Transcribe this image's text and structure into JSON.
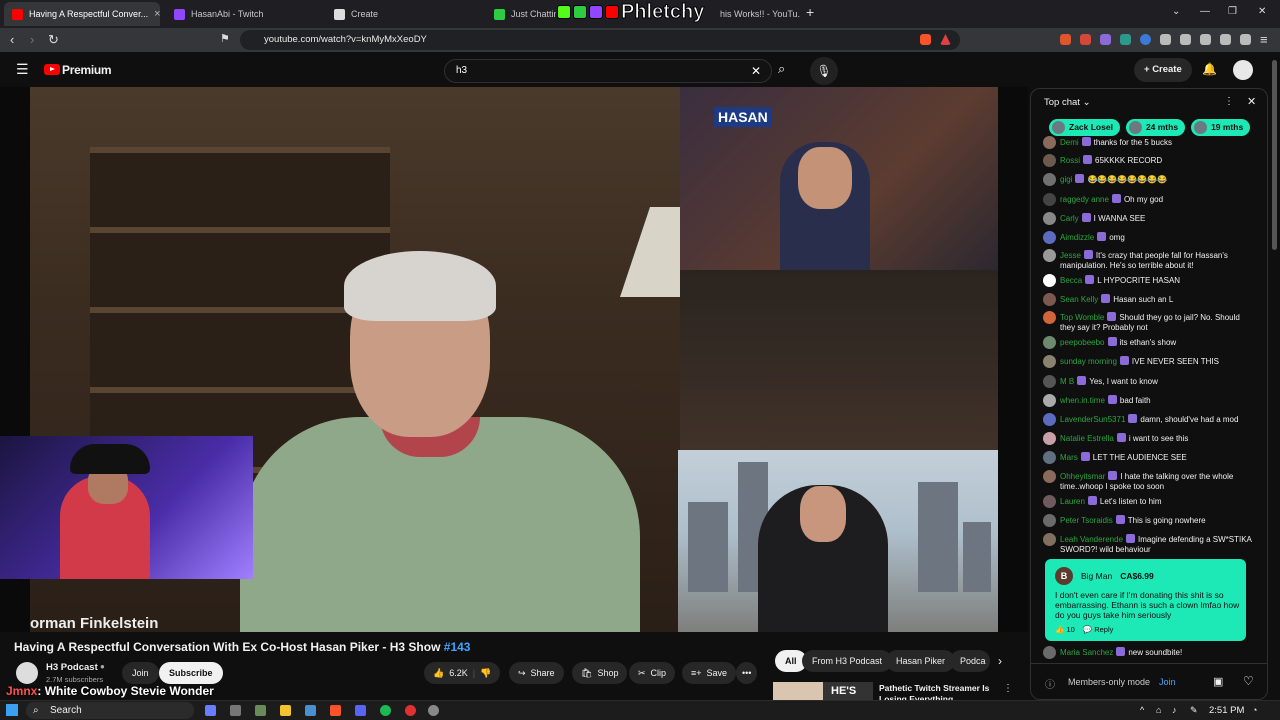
{
  "tabs": [
    {
      "title": "Having A Respectful Conver...",
      "fav": "#ff0000",
      "active": true
    },
    {
      "title": "HasanAbi - Twitch",
      "fav": "#9146ff"
    },
    {
      "title": "Create",
      "fav": "#ffffff"
    },
    {
      "title": "Just Chatting S...",
      "fav": "#2ecc40"
    },
    {
      "title": "his Works!! - YouTu...",
      "fav": "#ff0000"
    }
  ],
  "watermark": "Phletchy",
  "address": {
    "url": "youtube.com/watch?v=knMyMxXeoDY"
  },
  "youtube": {
    "brand": "Premium",
    "search_value": "h3",
    "create_label": "Create"
  },
  "video": {
    "nameplate": "orman Finkelstein",
    "pip_logo": "HASAN",
    "title": "Having A Respectful Conversation With Ex Co-Host Hasan Piker - H3 Show",
    "title_tag": "#143",
    "channel": "H3 Podcast",
    "subscribers": "2.7M subscribers",
    "join": "Join",
    "subscribe": "Subscribe",
    "likes": "6.2K",
    "share": "Share",
    "shop": "Shop",
    "clip": "Clip",
    "save": "Save",
    "more": "•••"
  },
  "overlay": {
    "name": "Jmnx",
    "text": ": White Cowboy Stevie Wonder"
  },
  "related_chips": [
    "All",
    "From H3 Podcast",
    "Hasan Piker",
    "Podca"
  ],
  "related_video": {
    "title_line1": "Pathetic Twitch Streamer Is",
    "title_line2": "Losing Everything",
    "thumb_text": "HE'S"
  },
  "chat": {
    "header": "Top chat",
    "tips": [
      {
        "label": "Zack Losel",
        "color": "#1de9b6"
      },
      {
        "label": "24 mths",
        "color": "#1de9b6"
      },
      {
        "label": "19 mths",
        "color": "#1de9b6"
      }
    ],
    "messages": [
      {
        "name": "Demi",
        "text": "thanks for the 5 bucks",
        "av": "#8a6a5a",
        "name_color": "#2ba640"
      },
      {
        "name": "Rossi",
        "text": "65KKKK RECORD",
        "av": "#6b5a4e",
        "name_color": "#2ba640"
      },
      {
        "name": "gigi",
        "text": "😂😂😂😂😂😂😂😂",
        "av": "#707070",
        "name_color": "#2ba640"
      },
      {
        "name": "raggedy anne",
        "text": "Oh my god",
        "av": "#444",
        "name_color": "#2ba640"
      },
      {
        "name": "Carly",
        "text": "I WANNA SEE",
        "av": "#888",
        "name_color": "#2ba640"
      },
      {
        "name": "Aimdizzle",
        "text": "omg",
        "av": "#5c6bc0",
        "name_color": "#2ba640"
      },
      {
        "name": "Jesse",
        "text": "It's crazy that people fall for Hassan's manipulation. He's so terrible about it!",
        "av": "#999",
        "name_color": "#2ba640"
      },
      {
        "name": "Becca",
        "text": "L HYPOCRITE HASAN",
        "av": "#ffffff",
        "name_color": "#2ba640"
      },
      {
        "name": "Sean Kelly",
        "text": "Hasan such an L",
        "av": "#7a5a50",
        "name_color": "#2ba640"
      },
      {
        "name": "Top Womble",
        "text": "Should they go to jail? No. Should they say it? Probably not",
        "av": "#d0643a",
        "name_color": "#2ba640"
      },
      {
        "name": "peepobeebo",
        "text": "its ethan's show",
        "av": "#6e8a6e",
        "name_color": "#2ba640"
      },
      {
        "name": "sunday morning",
        "text": "IVE NEVER SEEN THIS",
        "av": "#8a8270",
        "name_color": "#2ba640"
      },
      {
        "name": "M B",
        "text": "Yes, I want to know",
        "av": "#555",
        "name_color": "#2ba640"
      },
      {
        "name": "when.in.time",
        "text": "bad faith",
        "av": "#aaa",
        "name_color": "#2ba640"
      },
      {
        "name": "LavenderSun5371",
        "text": "damn, should've had a mod",
        "av": "#5c6bc0",
        "name_color": "#2ba640"
      },
      {
        "name": "Natalie Estrella",
        "text": "i want to see this",
        "av": "#c9a0a8",
        "name_color": "#2ba640"
      },
      {
        "name": "Mars",
        "text": "LET THE AUDIENCE SEE",
        "av": "#607080",
        "name_color": "#2ba640"
      },
      {
        "name": "Ohheyitsmar",
        "text": "I hate the talking over the whole time..whoop I spoke too soon",
        "av": "#8a6a5a",
        "name_color": "#2ba640"
      },
      {
        "name": "Lauren",
        "text": "Let's listen to him",
        "av": "#705a60",
        "name_color": "#2ba640"
      },
      {
        "name": "Peter Tsoraidis",
        "text": "This is going nowhere",
        "av": "#6a6a6a",
        "name_color": "#2ba640"
      },
      {
        "name": "Leah Vanderende",
        "text": "Imagine defending a SW*STIKA SWORD?! wild behaviour",
        "av": "#807060",
        "name_color": "#2ba640"
      }
    ],
    "superchat": {
      "initial": "B",
      "name": "Big Man",
      "amount": "CA$6.99",
      "text": "I don't even care if I'm donating this shit is so embarrassing. Ethann is such a clown lmfao how do you guys take him seriously",
      "likes": "10",
      "reply": "Reply"
    },
    "last_message": {
      "name": "Maria Sanchez",
      "text": "new soundbite!"
    },
    "footer_mode": "Members-only mode",
    "footer_join": "Join"
  },
  "taskbar": {
    "search": "Search",
    "time": "2:51 PM"
  }
}
